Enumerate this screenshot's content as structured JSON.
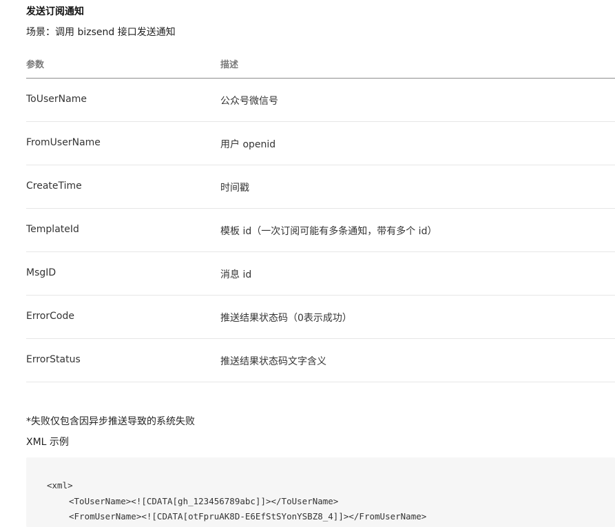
{
  "section": {
    "title": "发送订阅通知",
    "scene": "场景：调用 bizsend 接口发送通知"
  },
  "table": {
    "headers": {
      "param": "参数",
      "desc": "描述"
    },
    "rows": [
      {
        "param": "ToUserName",
        "desc": "公众号微信号"
      },
      {
        "param": "FromUserName",
        "desc": "用户 openid"
      },
      {
        "param": "CreateTime",
        "desc": "时间戳"
      },
      {
        "param": "TemplateId",
        "desc": "模板 id（一次订阅可能有多条通知，带有多个 id）"
      },
      {
        "param": "MsgID",
        "desc": "消息 id"
      },
      {
        "param": "ErrorCode",
        "desc": "推送结果状态码（0表示成功）"
      },
      {
        "param": "ErrorStatus",
        "desc": "推送结果状态码文字含义"
      }
    ]
  },
  "note": "*失败仅包含因异步推送导致的系统失败",
  "xml_example": {
    "title": "XML 示例",
    "lines": [
      "<xml>",
      "<ToUserName><![CDATA[gh_123456789abc]]></ToUserName>",
      "<FromUserName><![CDATA[otFpruAK8D-E6EfStSYonYSBZ8_4]]></FromUserName>"
    ]
  },
  "colors": {
    "header_text": "#7a7a7a",
    "header_rule": "#8c8c8c",
    "row_rule": "#e6e6e6",
    "code_background": "#f6f6f6"
  }
}
